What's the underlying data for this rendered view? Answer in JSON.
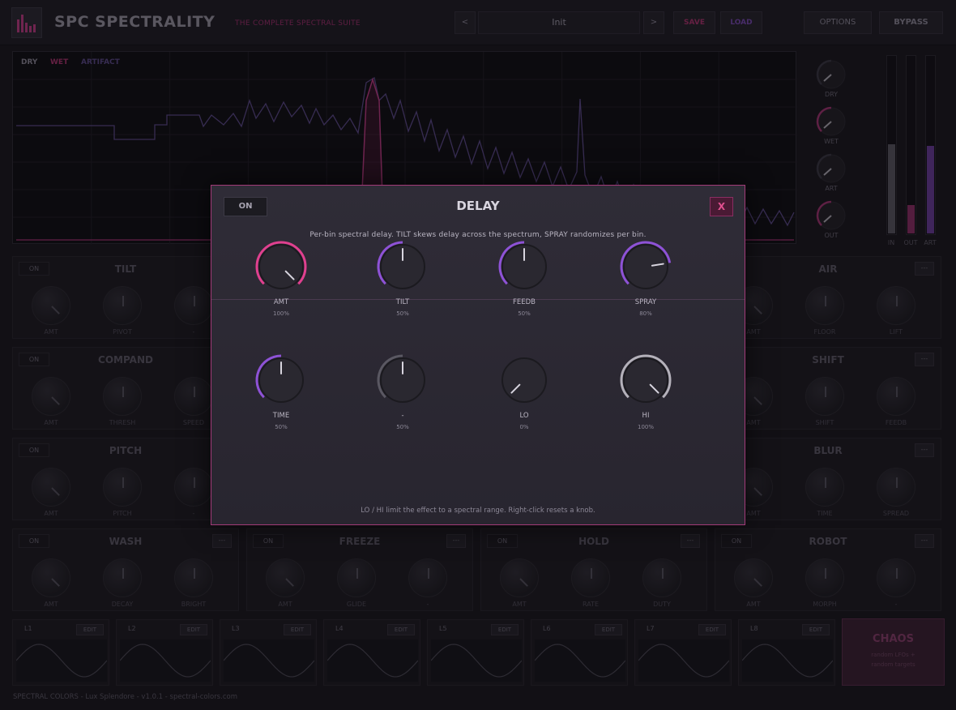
{
  "header": {
    "title": "SPC SPECTRALITY",
    "subtitle": "THE COMPLETE SPECTRAL SUITE",
    "prev_label": "<",
    "next_label": ">",
    "preset": "Init",
    "save_label": "SAVE",
    "load_label": "LOAD",
    "options_label": "OPTIONS",
    "bypass_label": "BYPASS"
  },
  "spectrum": {
    "legend_dry": "DRY",
    "legend_wet": "WET",
    "legend_artifact": "ARTIFACT"
  },
  "io": {
    "knobs": [
      "DRY",
      "WET",
      "ART",
      "OUT"
    ],
    "meters": [
      {
        "label": "IN",
        "level": 0.5,
        "color": "#5a5862"
      },
      {
        "label": "OUT",
        "level": 0.16,
        "color": "#8f2e66"
      },
      {
        "label": "ART",
        "level": 0.49,
        "color": "#6a3c9c"
      }
    ]
  },
  "modules": [
    {
      "title": "TILT",
      "on": "ON",
      "more": "",
      "knobs": [
        "AMT",
        "PIVOT",
        "-"
      ]
    },
    {
      "title": "AIR",
      "on": "",
      "more": "---",
      "knobs": [
        "AMT",
        "FLOOR",
        "LIFT"
      ]
    },
    {
      "title": "COMPAND",
      "on": "ON",
      "more": "",
      "knobs": [
        "AMT",
        "THRESH",
        "SPEED"
      ]
    },
    {
      "title": "SHIFT",
      "on": "",
      "more": "---",
      "knobs": [
        "AMT",
        "SHIFT",
        "FEEDB"
      ]
    },
    {
      "title": "PITCH",
      "on": "ON",
      "more": "",
      "knobs": [
        "AMT",
        "PITCH",
        "-"
      ]
    },
    {
      "title": "BLUR",
      "on": "",
      "more": "---",
      "knobs": [
        "AMT",
        "TIME",
        "SPREAD"
      ]
    },
    {
      "title": "WASH",
      "on": "ON",
      "more": "---",
      "knobs": [
        "AMT",
        "DECAY",
        "BRIGHT"
      ]
    },
    {
      "title": "FREEZE",
      "on": "ON",
      "more": "---",
      "knobs": [
        "AMT",
        "GLIDE",
        "-"
      ]
    },
    {
      "title": "HOLD",
      "on": "ON",
      "more": "---",
      "knobs": [
        "AMT",
        "RATE",
        "DUTY"
      ]
    },
    {
      "title": "ROBOT",
      "on": "ON",
      "more": "---",
      "knobs": [
        "AMT",
        "MORPH",
        "-"
      ]
    }
  ],
  "lfos": [
    {
      "name": "L1",
      "edit": "EDIT"
    },
    {
      "name": "L2",
      "edit": "EDIT"
    },
    {
      "name": "L3",
      "edit": "EDIT"
    },
    {
      "name": "L4",
      "edit": "EDIT"
    },
    {
      "name": "L5",
      "edit": "EDIT"
    },
    {
      "name": "L6",
      "edit": "EDIT"
    },
    {
      "name": "L7",
      "edit": "EDIT"
    },
    {
      "name": "L8",
      "edit": "EDIT"
    }
  ],
  "chaos": {
    "title": "CHAOS",
    "line1": "random LFOs +",
    "line2": "random targets"
  },
  "footer": "SPECTRAL COLORS - Lux Splendore - v1.0.1 - spectral-colors.com",
  "modal": {
    "on_label": "ON",
    "title": "DELAY",
    "close_label": "X",
    "description": "Per-bin spectral delay. TILT skews delay across the spectrum, SPRAY randomizes per bin.",
    "hint": "LO / HI limit the effect to a spectral range. Right-click resets a knob.",
    "knobs": [
      {
        "label": "AMT",
        "value": "100%",
        "level": 1.0,
        "color": "#e0408f"
      },
      {
        "label": "TILT",
        "value": "50%",
        "level": 0.5,
        "color": "#8e52d6"
      },
      {
        "label": "FEEDB",
        "value": "50%",
        "level": 0.5,
        "color": "#8e52d6"
      },
      {
        "label": "SPRAY",
        "value": "80%",
        "level": 0.8,
        "color": "#8e52d6"
      },
      {
        "label": "TIME",
        "value": "50%",
        "level": 0.5,
        "color": "#8e52d6"
      },
      {
        "label": "-",
        "value": "50%",
        "level": 0.5,
        "color": "#5a5862"
      },
      {
        "label": "LO",
        "value": "0%",
        "level": 0.0,
        "color": "#8e52d6"
      },
      {
        "label": "HI",
        "value": "100%",
        "level": 1.0,
        "color": "#b4b1ba"
      }
    ]
  },
  "colors": {
    "accent_pink": "#c23b86",
    "accent_purple": "#6a3c9c",
    "background": "#18171c"
  }
}
